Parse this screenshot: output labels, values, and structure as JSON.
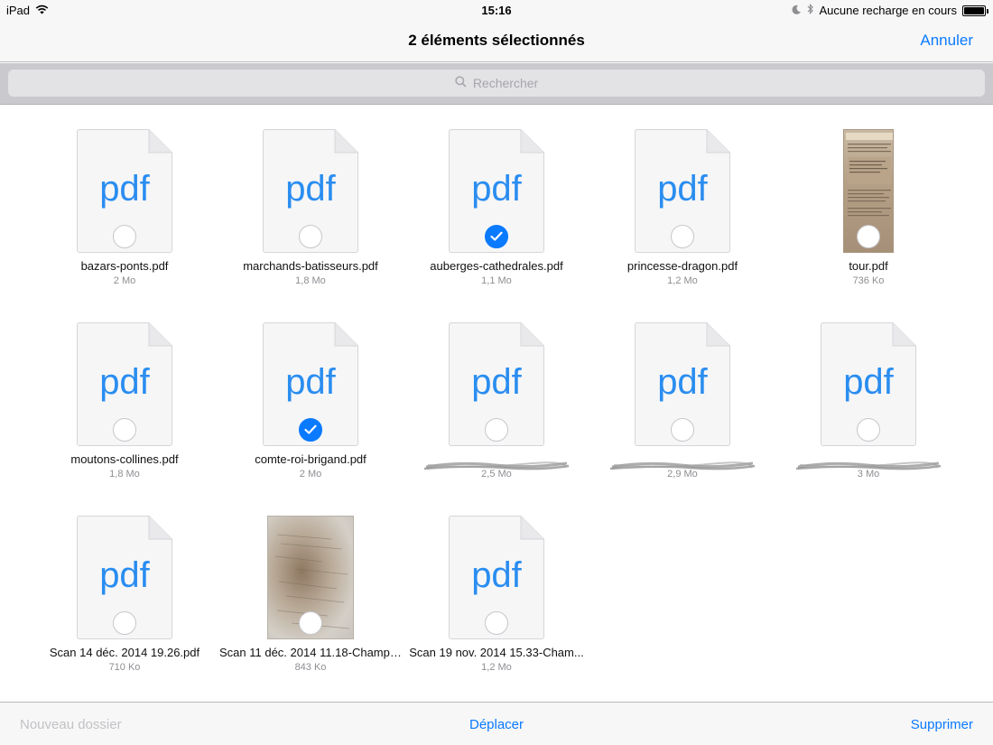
{
  "status": {
    "device": "iPad",
    "time": "15:16",
    "battery_text": "Aucune recharge en cours",
    "battery_level": 1.0
  },
  "nav": {
    "title": "2 éléments sélectionnés",
    "cancel_label": "Annuler"
  },
  "search": {
    "placeholder": "Rechercher"
  },
  "files": [
    {
      "name": "bazars-ponts.pdf",
      "size": "2 Mo",
      "type": "pdf",
      "selected": false
    },
    {
      "name": "marchands-batisseurs.pdf",
      "size": "1,8 Mo",
      "type": "pdf",
      "selected": false
    },
    {
      "name": "auberges-cathedrales.pdf",
      "size": "1,1 Mo",
      "type": "pdf",
      "selected": true
    },
    {
      "name": "princesse-dragon.pdf",
      "size": "1,2 Mo",
      "type": "pdf",
      "selected": false
    },
    {
      "name": "tour.pdf",
      "size": "736 Ko",
      "type": "thumb-tour",
      "selected": false
    },
    {
      "name": "moutons-collines.pdf",
      "size": "1,8 Mo",
      "type": "pdf",
      "selected": false
    },
    {
      "name": "comte-roi-brigand.pdf",
      "size": "2 Mo",
      "type": "pdf",
      "selected": true
    },
    {
      "name": "",
      "size": "2,5 Mo",
      "type": "pdf",
      "selected": false,
      "redacted": true
    },
    {
      "name": "",
      "size": "2,9 Mo",
      "type": "pdf",
      "selected": false,
      "redacted": true
    },
    {
      "name": "",
      "size": "3 Mo",
      "type": "pdf",
      "selected": false,
      "redacted": true
    },
    {
      "name": "Scan 14 déc. 2014 19.26.pdf",
      "size": "710 Ko",
      "type": "pdf",
      "selected": false
    },
    {
      "name": "Scan 11 déc. 2014 11.18-Champi...",
      "size": "843 Ko",
      "type": "thumb-scan",
      "selected": false
    },
    {
      "name": "Scan 19 nov. 2014 15.33-Cham...",
      "size": "1,2 Mo",
      "type": "pdf",
      "selected": false
    }
  ],
  "pdf_icon_label": "pdf",
  "toolbar": {
    "new_folder_label": "Nouveau dossier",
    "move_label": "Déplacer",
    "delete_label": "Supprimer"
  },
  "colors": {
    "accent": "#0a7aff",
    "pdf_text": "#2a8df0",
    "disabled": "#c2c2c6"
  }
}
